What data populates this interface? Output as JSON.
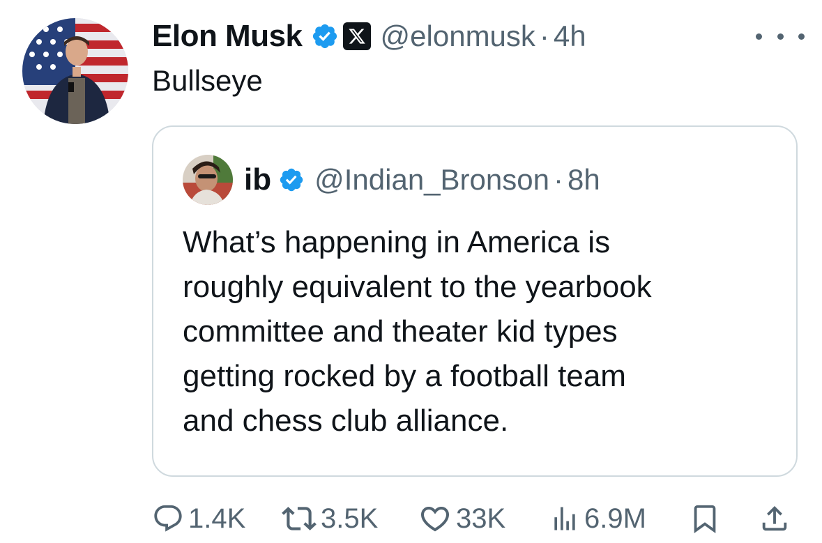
{
  "tweet": {
    "display_name": "Elon Musk",
    "handle": "@elonmusk",
    "separator": "·",
    "time": "4h",
    "text": "Bullseye",
    "icons": {
      "verified": "verified-badge-icon",
      "affiliation": "x-logo-icon",
      "more": "more-options-icon"
    }
  },
  "quote": {
    "display_name": "ib",
    "handle": "@Indian_Bronson",
    "separator": "·",
    "time": "8h",
    "lines": [
      "What’s happening in America is",
      "roughly equivalent to the yearbook",
      "committee and theater kid types",
      "getting rocked by a football team",
      "and chess club alliance."
    ]
  },
  "actions": {
    "replies": "1.4K",
    "reposts": "3.5K",
    "likes": "33K",
    "views": "6.9M"
  },
  "colors": {
    "text": "#0f1419",
    "secondary": "#536471",
    "verified": "#1d9bf0",
    "border": "#cfd9de"
  }
}
